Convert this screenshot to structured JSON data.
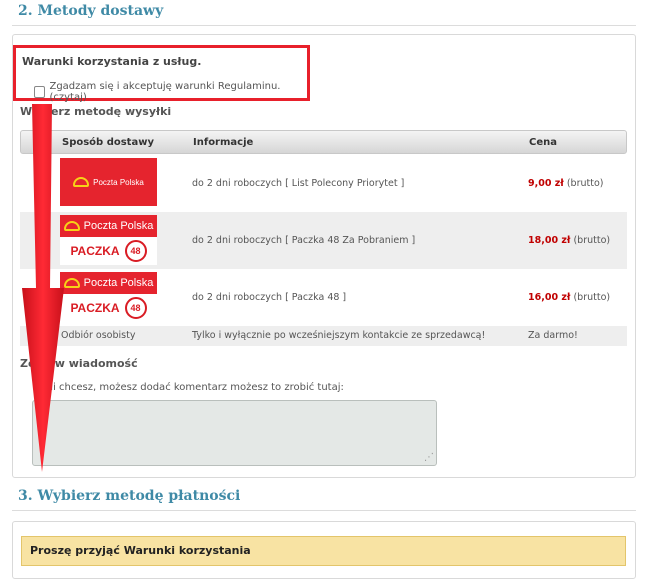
{
  "section2": {
    "title": "2. Metody dostawy"
  },
  "terms": {
    "title": "Warunki korzystania z usług.",
    "checkbox_label": "Zgadzam się i akceptuję warunki Regulaminu. (czytaj)"
  },
  "shipping": {
    "label": "Wybierz metodę wysyłki",
    "columns": [
      "Sposób dostawy",
      "Informacje",
      "Cena"
    ],
    "rows": [
      {
        "logo": "Poczta Polska",
        "info": "do 2 dni roboczych [ List Polecony Priorytet ]",
        "price": "9,00 zł",
        "suffix": "(brutto)"
      },
      {
        "logo": "Poczta Polska",
        "logo_sub": "PACZKA",
        "logo_num": "48",
        "info": "do 2 dni roboczych [ Paczka 48 Za Pobraniem ]",
        "price": "18,00 zł",
        "suffix": "(brutto)"
      },
      {
        "logo": "Poczta Polska",
        "logo_sub": "PACZKA",
        "logo_num": "48",
        "info": "do 2 dni roboczych [ Paczka 48 ]",
        "price": "16,00 zł",
        "suffix": "(brutto)"
      },
      {
        "name": "Odbiór osobisty",
        "info": "Tylko i wyłącznie po wcześniejszym kontakcie ze sprzedawcą!",
        "price": "Za darmo!"
      }
    ]
  },
  "message": {
    "label": "Zostaw wiadomość",
    "hint": "Jeśli chcesz, możesz dodać komentarz możesz to zrobić tutaj:",
    "value": ""
  },
  "section3": {
    "title": "3. Wybierz metodę płatności"
  },
  "payment": {
    "alert": "Proszę przyjąć Warunki korzystania"
  },
  "colors": {
    "accent": "#3f8aa6",
    "highlight": "#e8202b",
    "price": "#c00000",
    "alert_bg": "#f8e3a3"
  },
  "icons": [
    "poczta-polska-logo",
    "paczka48-logo",
    "down-arrow-annotation",
    "resize-grip-icon"
  ]
}
